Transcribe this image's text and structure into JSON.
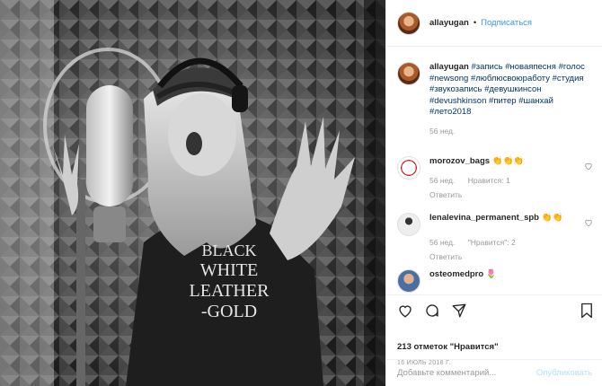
{
  "header": {
    "username": "allayugan",
    "separator": "•",
    "follow_label": "Подписаться"
  },
  "caption": {
    "author": "allayugan",
    "hashtags": [
      "#запись",
      "#новаяпесня",
      "#голос",
      "#newsong",
      "#люблюсвоюработу",
      "#студия",
      "#звукозапись",
      "#девушкинсон",
      "#devushkinson",
      "#питер",
      "#шанхай",
      "#лето2018"
    ],
    "age": "56 нед."
  },
  "comments": [
    {
      "author": "morozov_bags",
      "text": "👏👏👏",
      "age": "56 нед.",
      "likes": "Нравится: 1",
      "reply": "Ответить"
    },
    {
      "author": "lenalevina_permanent_spb",
      "text": "👏👏",
      "age": "56 нед.",
      "likes": "\"Нравится\": 2",
      "reply": "Ответить"
    },
    {
      "author": "osteomedpro",
      "text": "🌷"
    }
  ],
  "actions": {
    "likes_summary": "213 отметок \"Нравится\"",
    "date": "16 ИЮЛЬ 2018 Г."
  },
  "add_comment": {
    "placeholder": "Добавьте комментарий...",
    "publish_label": "Опубликовать"
  },
  "photo": {
    "shirt_line1": "BLACK",
    "shirt_line2": "WHITE",
    "shirt_line3": "LEATHER",
    "shirt_line4": "-GOLD"
  },
  "colors": {
    "link": "#003569",
    "follow": "#3897f0",
    "muted": "#999999",
    "publish_disabled": "#b2dffc"
  }
}
